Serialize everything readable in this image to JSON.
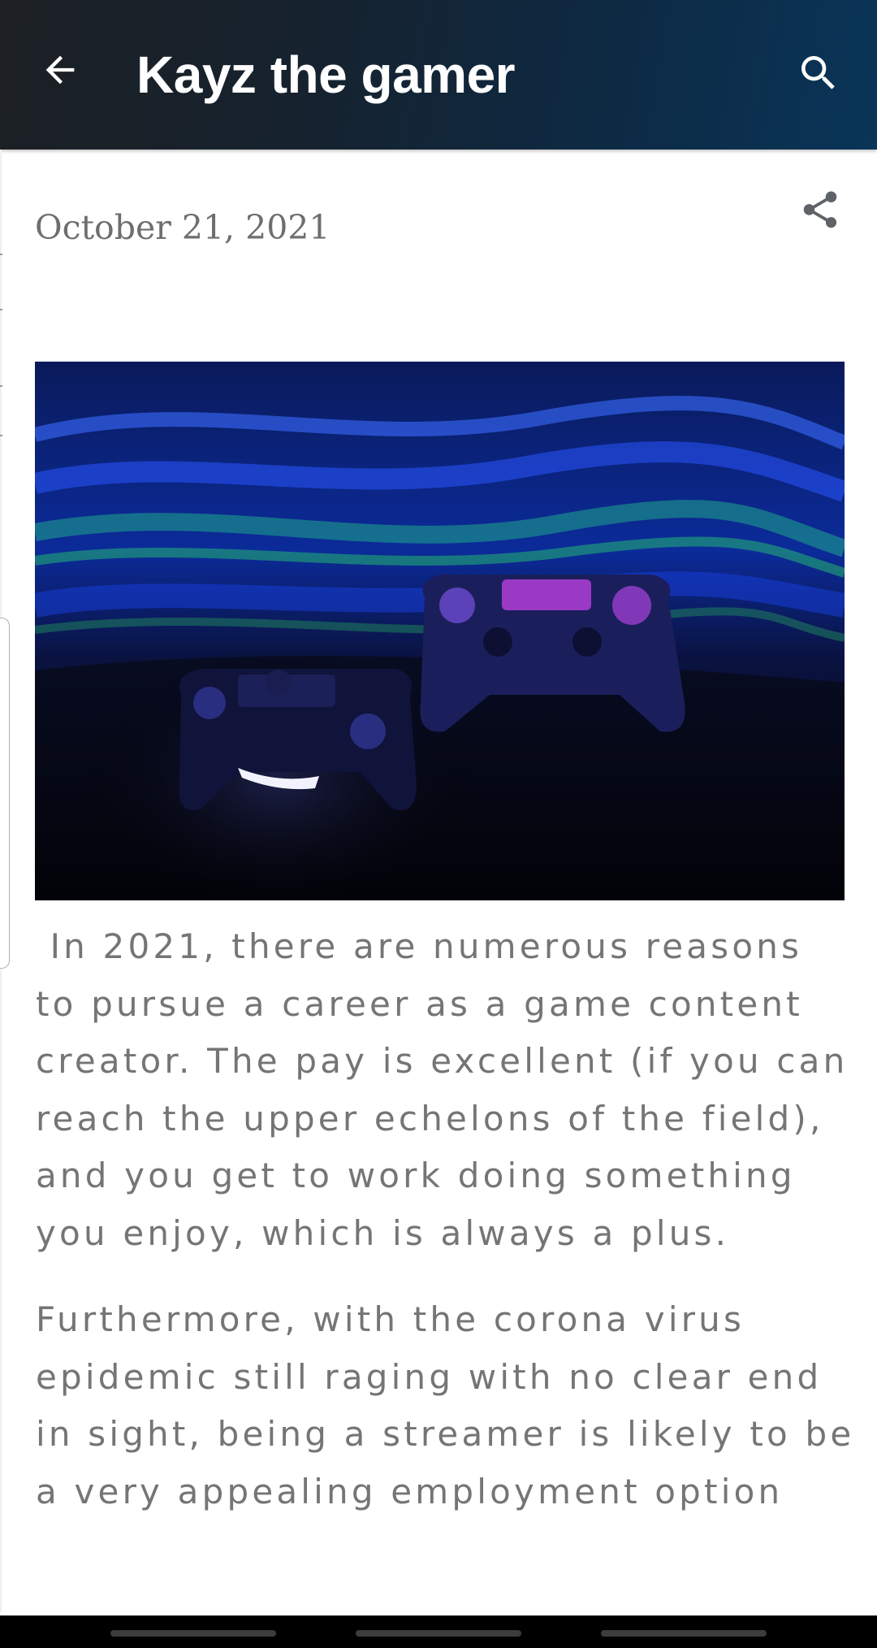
{
  "app_bar": {
    "title": "Kayz the gamer",
    "back_icon": "arrow-back-icon",
    "search_icon": "search-icon",
    "background_color": "#14263a"
  },
  "post": {
    "date": "October 21, 2021",
    "share_icon": "share-icon",
    "hero_image_subject": "two game controllers under blue and green light trails",
    "paragraphs": [
      " In 2021, there are numerous reasons to pursue a career as a game content creator. The pay is excellent (if you can reach the upper echelons of the field), and you get to work doing something you enjoy, which is always a plus.",
      "Furthermore, with the corona virus epidemic still raging with no clear end in sight, being a streamer is likely to be a very appealing employment option"
    ]
  },
  "colors": {
    "body_text": "#757575",
    "date_text": "#6e6e6e",
    "icon_gray": "#5f6368"
  }
}
